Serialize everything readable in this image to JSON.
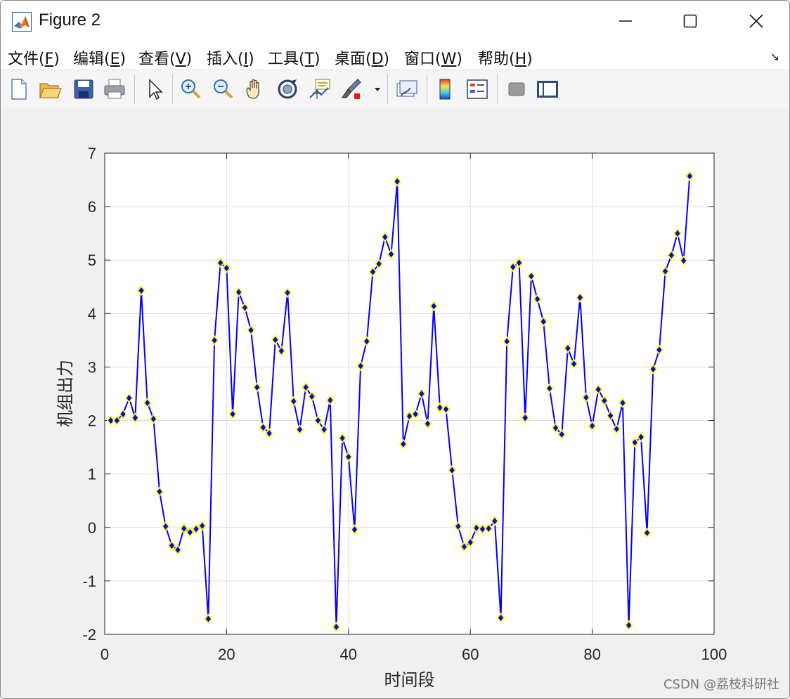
{
  "window": {
    "title": "Figure 2",
    "icon": "matlab-icon",
    "controls": [
      "minimize-icon",
      "maximize-icon",
      "close-icon"
    ]
  },
  "menu": {
    "items": [
      {
        "text": "文件(",
        "key": "F",
        "end": ")"
      },
      {
        "text": "编辑(",
        "key": "E",
        "end": ")"
      },
      {
        "text": "查看(",
        "key": "V",
        "end": ")"
      },
      {
        "text": "插入(",
        "key": "I",
        "end": ")"
      },
      {
        "text": "工具(",
        "key": "T",
        "end": ")"
      },
      {
        "text": "桌面(",
        "key": "D",
        "end": ")"
      },
      {
        "text": "窗口(",
        "key": "W",
        "end": ")"
      },
      {
        "text": "帮助(",
        "key": "H",
        "end": ")"
      }
    ]
  },
  "toolbar": {
    "icons": [
      "new-figure-icon",
      "open-file-icon",
      "save-icon",
      "print-icon",
      "pointer-icon",
      "zoom-in-icon",
      "zoom-out-icon",
      "pan-icon",
      "rotate-3d-icon",
      "data-cursor-icon",
      "brush-icon",
      "link-plot-icon",
      "colorbar-icon",
      "legend-icon",
      "hide-plot-tools-icon",
      "show-plot-tools-icon"
    ]
  },
  "chart_data": {
    "type": "line",
    "xlabel": "时间段",
    "ylabel": "机组出力",
    "xlim": [
      0,
      100
    ],
    "ylim": [
      -2,
      7
    ],
    "xticks": [
      0,
      20,
      40,
      60,
      80,
      100
    ],
    "yticks": [
      -2,
      -1,
      0,
      1,
      2,
      3,
      4,
      5,
      6,
      7
    ],
    "grid": true,
    "line_color": "#0000ff",
    "marker": "diamond",
    "marker_face": "#0000ff",
    "marker_edge": "#ffff00",
    "x": [
      1,
      2,
      3,
      4,
      5,
      6,
      7,
      8,
      9,
      10,
      11,
      12,
      13,
      14,
      15,
      16,
      17,
      18,
      19,
      20,
      21,
      22,
      23,
      24,
      25,
      26,
      27,
      28,
      29,
      30,
      31,
      32,
      33,
      34,
      35,
      36,
      37,
      38,
      39,
      40,
      41,
      42,
      43,
      44,
      45,
      46,
      47,
      48,
      49,
      50,
      51,
      52,
      53,
      54,
      55,
      56,
      57,
      58,
      59,
      60,
      61,
      62,
      63,
      64,
      65,
      66,
      67,
      68,
      69,
      70,
      71,
      72,
      73,
      74,
      75,
      76,
      77,
      78,
      79,
      80,
      81,
      82,
      83,
      84,
      85,
      86,
      87,
      88,
      89,
      90,
      91,
      92,
      93,
      94,
      95,
      96
    ],
    "y": [
      2.0,
      2.0,
      2.12,
      2.42,
      2.05,
      4.43,
      2.33,
      2.03,
      0.67,
      0.02,
      -0.34,
      -0.42,
      -0.02,
      -0.09,
      -0.03,
      0.03,
      -1.71,
      3.5,
      4.95,
      4.85,
      2.12,
      4.4,
      4.11,
      3.69,
      2.62,
      1.87,
      1.76,
      3.51,
      3.3,
      4.39,
      2.36,
      1.83,
      2.62,
      2.45,
      2.0,
      1.83,
      2.38,
      -1.86,
      1.67,
      1.32,
      -0.04,
      3.02,
      3.48,
      4.78,
      4.93,
      5.43,
      5.11,
      6.47,
      1.56,
      2.08,
      2.12,
      2.5,
      1.94,
      4.14,
      2.24,
      2.21,
      1.07,
      0.02,
      -0.36,
      -0.28,
      -0.01,
      -0.03,
      -0.02,
      0.12,
      -1.69,
      3.48,
      4.87,
      4.95,
      2.05,
      4.7,
      4.27,
      3.85,
      2.6,
      1.86,
      1.74,
      3.35,
      3.06,
      4.3,
      2.43,
      1.9,
      2.58,
      2.37,
      2.09,
      1.84,
      2.33,
      -1.83,
      1.59,
      1.69,
      -0.1,
      2.96,
      3.32,
      4.79,
      5.09,
      5.5,
      4.99,
      6.57
    ]
  },
  "watermark": "CSDN @荔枝科研社"
}
